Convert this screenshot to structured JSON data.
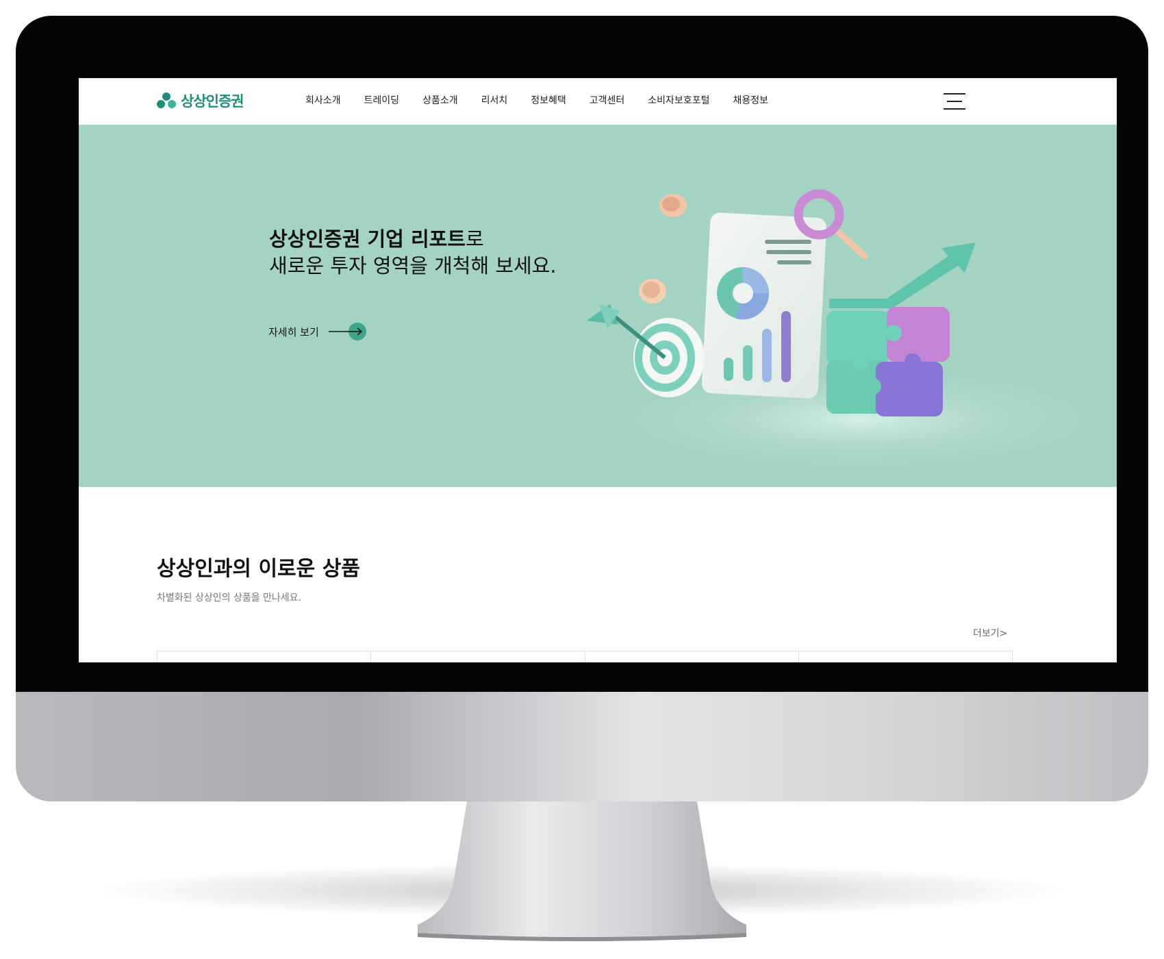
{
  "header": {
    "logo_text": "상상인증권",
    "nav": [
      "회사소개",
      "트레이딩",
      "상품소개",
      "리서치",
      "정보혜택",
      "고객센터",
      "소비자보호포털",
      "채용정보"
    ]
  },
  "hero": {
    "title_bold": "상상인증권 기업 리포트",
    "title_suffix": "로",
    "title_line2": "새로운 투자 영역을 개척해 보세요.",
    "more_label": "자세히 보기"
  },
  "products": {
    "title": "상상인과의 이로운 상품",
    "subtitle": "차별화된 상상인의 상품을 만나세요.",
    "more_label": "더보기>"
  },
  "colors": {
    "hero_bg": "#a5d3c3",
    "brand": "#1f8f7a",
    "accent_circle": "#3da58a"
  }
}
